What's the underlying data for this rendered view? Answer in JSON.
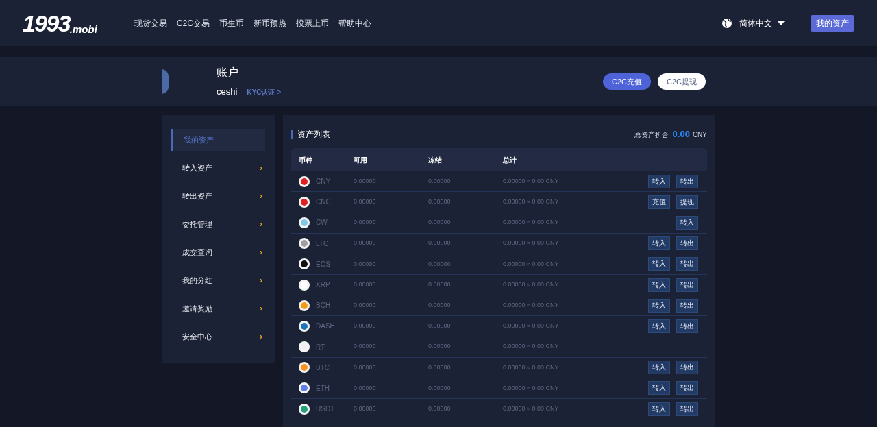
{
  "header": {
    "logo_main": "1993",
    "logo_suffix": ".mobi",
    "nav": [
      "现货交易",
      "C2C交易",
      "币生币",
      "新币预热",
      "投票上币",
      "帮助中心"
    ],
    "language": "简体中文",
    "my_assets_button": "我的资产"
  },
  "account": {
    "title": "账户",
    "username": "ceshi",
    "kyc_link": "KYC认证 >",
    "buttons": [
      {
        "label": "C2C充值",
        "kind": "primary"
      },
      {
        "label": "C2C提现",
        "kind": "outline"
      }
    ]
  },
  "sidebar": {
    "items": [
      {
        "label": "我的资产",
        "selected": true
      },
      {
        "label": "转入资产",
        "selected": false
      },
      {
        "label": "转出资产",
        "selected": false
      },
      {
        "label": "委托管理",
        "selected": false
      },
      {
        "label": "成交查询",
        "selected": false
      },
      {
        "label": "我的分红",
        "selected": false
      },
      {
        "label": "邀请奖励",
        "selected": false
      },
      {
        "label": "安全中心",
        "selected": false
      }
    ],
    "chevron": "›"
  },
  "assets": {
    "title": "资产列表",
    "total_label": "总资产折合",
    "total_value": "0.00",
    "total_unit": "CNY",
    "columns": [
      "币种",
      "可用",
      "冻结",
      "总计"
    ],
    "rows": [
      {
        "coin": "CNY",
        "color": "#e02020",
        "available": "0.00000",
        "frozen": "0.00000",
        "total": "0.00000 ≈ 0.00 CNY",
        "actions": [
          "转入",
          "转出"
        ]
      },
      {
        "coin": "CNC",
        "color": "#e02020",
        "available": "0.00000",
        "frozen": "0.00000",
        "total": "0.00000 ≈ 0.00 CNY",
        "actions": [
          "充值",
          "提现"
        ]
      },
      {
        "coin": "CW",
        "color": "#7fc8e8",
        "available": "0.00000",
        "frozen": "0.00000",
        "total": "0.00000 ≈ 0.00 CNY",
        "actions": [
          "转入"
        ]
      },
      {
        "coin": "LTC",
        "color": "#a0a0a0",
        "available": "0.00000",
        "frozen": "0.00000",
        "total": "0.00000 ≈ 0.00 CNY",
        "actions": [
          "转入",
          "转出"
        ]
      },
      {
        "coin": "EOS",
        "color": "#101010",
        "available": "0.00000",
        "frozen": "0.00000",
        "total": "0.00000 ≈ 0.00 CNY",
        "actions": [
          "转入",
          "转出"
        ]
      },
      {
        "coin": "XRP",
        "color": "#ffffff",
        "available": "0.00000",
        "frozen": "0.00000",
        "total": "0.00000 ≈ 0.00 CNY",
        "actions": [
          "转入",
          "转出"
        ]
      },
      {
        "coin": "BCH",
        "color": "#f39c12",
        "available": "0.00000",
        "frozen": "0.00000",
        "total": "0.00000 ≈ 0.00 CNY",
        "actions": [
          "转入",
          "转出"
        ]
      },
      {
        "coin": "DASH",
        "color": "#1c75bc",
        "available": "0.00000",
        "frozen": "0.00000",
        "total": "0.00000 ≈ 0.00 CNY",
        "actions": [
          "转入",
          "转出"
        ]
      },
      {
        "coin": "RT",
        "color": "#f0f0f0",
        "available": "0.00000",
        "frozen": "0.00000",
        "total": "0.00000 ≈ 0.00 CNY",
        "actions": []
      },
      {
        "coin": "BTC",
        "color": "#f7931a",
        "available": "0.00000",
        "frozen": "0.00000",
        "total": "0.00000 ≈ 0.00 CNY",
        "actions": [
          "转入",
          "转出"
        ]
      },
      {
        "coin": "ETH",
        "color": "#627eea",
        "available": "0.00000",
        "frozen": "0.00000",
        "total": "0.00000 ≈ 0.00 CNY",
        "actions": [
          "转入",
          "转出"
        ]
      },
      {
        "coin": "USDT",
        "color": "#26a17b",
        "available": "0.00000",
        "frozen": "0.00000",
        "total": "0.00000 ≈ 0.00 CNY",
        "actions": [
          "转入",
          "转出"
        ]
      }
    ]
  }
}
